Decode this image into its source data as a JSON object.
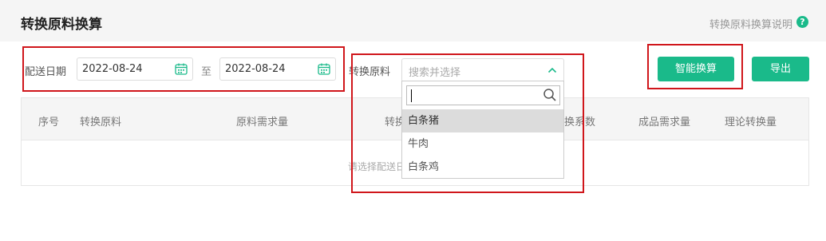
{
  "header": {
    "title": "转换原料换算",
    "help_text": "转换原料换算说明",
    "help_icon": "?"
  },
  "filters": {
    "date_label": "配送日期",
    "date_start": "2022-08-24",
    "date_sep": "至",
    "date_end": "2022-08-24",
    "material_label": "转换原料",
    "material_placeholder": "搜索并选择"
  },
  "actions": {
    "calc_label": "智能换算",
    "export_label": "导出"
  },
  "table": {
    "columns": [
      "序号",
      "转换原料",
      "原料需求量",
      "转换",
      "换系数",
      "成品需求量",
      "理论转换量"
    ],
    "empty_text": "请选择配送日"
  },
  "dropdown": {
    "options": [
      "白条猪",
      "牛肉",
      "白条鸡"
    ],
    "highlighted_index": 0
  },
  "colors": {
    "accent": "#1aba8a",
    "annotation_red": "#d0161b"
  }
}
